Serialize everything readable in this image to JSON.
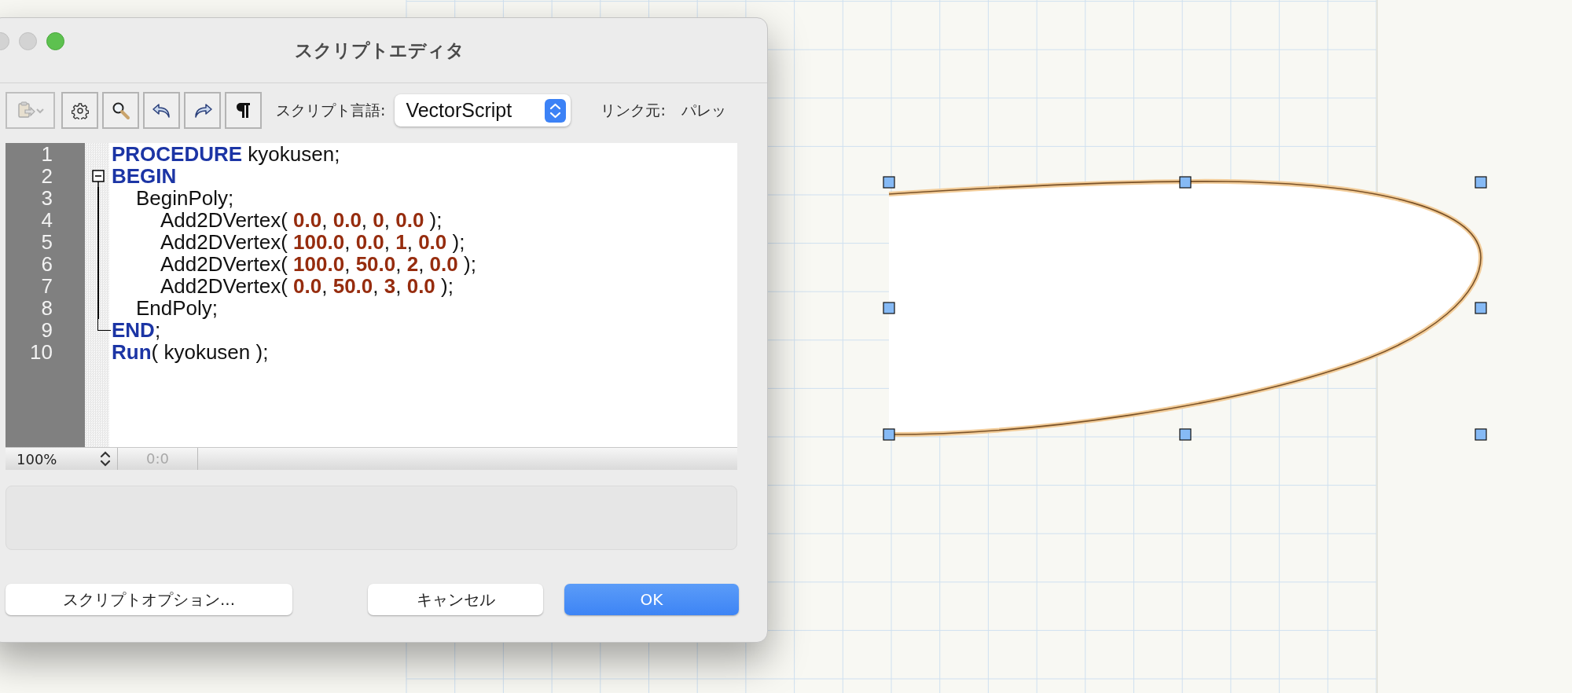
{
  "window": {
    "title": "スクリプトエディタ"
  },
  "toolbar": [
    {
      "kind": "paste",
      "disabled": true
    },
    {
      "kind": "settings",
      "disabled": false
    },
    {
      "kind": "search",
      "disabled": false
    },
    {
      "kind": "undo",
      "disabled": false
    },
    {
      "kind": "redo",
      "disabled": false
    },
    {
      "kind": "pilcrow",
      "disabled": false
    }
  ],
  "language": {
    "label": "スクリプト言語:",
    "value": "VectorScript"
  },
  "link": {
    "label": "リンク元:",
    "value": "パレッ"
  },
  "code": {
    "lines": [
      {
        "number": "1",
        "tokens": [
          {
            "kind": "keyword",
            "text": "PROCEDURE"
          },
          {
            "kind": "text",
            "text": " kyokusen;"
          }
        ]
      },
      {
        "number": "2",
        "expanded": true,
        "tokens": [
          {
            "kind": "keyword",
            "text": "BEGIN"
          }
        ],
        "children": [
          {
            "number": "3",
            "tokens": [
              {
                "kind": "text",
                "text": "BeginPoly;"
              }
            ],
            "children": [
              {
                "number": "4",
                "tokens": [
                  {
                    "kind": "text",
                    "text": "Add2DVertex( "
                  },
                  {
                    "kind": "number",
                    "text": "0.0"
                  },
                  {
                    "kind": "text",
                    "text": ", "
                  },
                  {
                    "kind": "number",
                    "text": "0.0"
                  },
                  {
                    "kind": "text",
                    "text": ", "
                  },
                  {
                    "kind": "number",
                    "text": "0"
                  },
                  {
                    "kind": "text",
                    "text": ", "
                  },
                  {
                    "kind": "number",
                    "text": "0.0"
                  },
                  {
                    "kind": "text",
                    "text": " );"
                  }
                ]
              },
              {
                "number": "5",
                "tokens": [
                  {
                    "kind": "text",
                    "text": "Add2DVertex( "
                  },
                  {
                    "kind": "number",
                    "text": "100.0"
                  },
                  {
                    "kind": "text",
                    "text": ", "
                  },
                  {
                    "kind": "number",
                    "text": "0.0"
                  },
                  {
                    "kind": "text",
                    "text": ", "
                  },
                  {
                    "kind": "number",
                    "text": "1"
                  },
                  {
                    "kind": "text",
                    "text": ", "
                  },
                  {
                    "kind": "number",
                    "text": "0.0"
                  },
                  {
                    "kind": "text",
                    "text": " );"
                  }
                ]
              },
              {
                "number": "6",
                "tokens": [
                  {
                    "kind": "text",
                    "text": "Add2DVertex( "
                  },
                  {
                    "kind": "number",
                    "text": "100.0"
                  },
                  {
                    "kind": "text",
                    "text": ", "
                  },
                  {
                    "kind": "number",
                    "text": "50.0"
                  },
                  {
                    "kind": "text",
                    "text": ", "
                  },
                  {
                    "kind": "number",
                    "text": "2"
                  },
                  {
                    "kind": "text",
                    "text": ", "
                  },
                  {
                    "kind": "number",
                    "text": "0.0"
                  },
                  {
                    "kind": "text",
                    "text": " );"
                  }
                ]
              },
              {
                "number": "7",
                "tokens": [
                  {
                    "kind": "text",
                    "text": "Add2DVertex( "
                  },
                  {
                    "kind": "number",
                    "text": "0.0"
                  },
                  {
                    "kind": "text",
                    "text": ", "
                  },
                  {
                    "kind": "number",
                    "text": "50.0"
                  },
                  {
                    "kind": "text",
                    "text": ", "
                  },
                  {
                    "kind": "number",
                    "text": "3"
                  },
                  {
                    "kind": "text",
                    "text": ", "
                  },
                  {
                    "kind": "number",
                    "text": "0.0"
                  },
                  {
                    "kind": "text",
                    "text": " );"
                  }
                ]
              }
            ]
          },
          {
            "number": "8",
            "tokens": [
              {
                "kind": "text",
                "text": "EndPoly;"
              }
            ]
          }
        ]
      },
      {
        "number": "9",
        "tokens": [
          {
            "kind": "keyword",
            "text": "END"
          },
          {
            "kind": "text",
            "text": ";"
          }
        ]
      },
      {
        "number": "10",
        "tokens": [
          {
            "kind": "keyword",
            "text": "Run"
          },
          {
            "kind": "text",
            "text": "( kyokusen );"
          }
        ]
      }
    ]
  },
  "status_bar": {
    "zoom": "100%",
    "position": "0:0"
  },
  "buttons": [
    {
      "label": "スクリプトオプション...",
      "kind": "normal"
    },
    {
      "label": "キャンセル",
      "kind": "normal"
    },
    {
      "label": "OK",
      "kind": "default"
    }
  ],
  "canvas": {
    "shape_selected": true
  }
}
